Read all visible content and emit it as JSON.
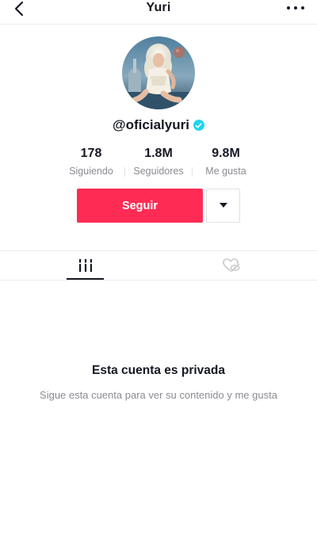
{
  "header": {
    "title": "Yuri",
    "back_icon": "chevron-left-icon",
    "more_icon": "more-horizontal-icon"
  },
  "profile": {
    "username": "@oficialyuri",
    "verified": true,
    "verified_color": "#20d5ec"
  },
  "stats": [
    {
      "value": "178",
      "label": "Siguiendo"
    },
    {
      "value": "1.8M",
      "label": "Seguidores"
    },
    {
      "value": "9.8M",
      "label": "Me gusta"
    }
  ],
  "actions": {
    "follow_label": "Seguir",
    "follow_color": "#fe2c55",
    "dropdown_icon": "caret-down-icon"
  },
  "tabs": [
    {
      "icon": "videos-grid-icon",
      "active": true
    },
    {
      "icon": "liked-heart-hidden-icon",
      "active": false
    }
  ],
  "private": {
    "title": "Esta cuenta es privada",
    "subtitle": "Sigue esta cuenta para ver su contenido y me gusta"
  }
}
